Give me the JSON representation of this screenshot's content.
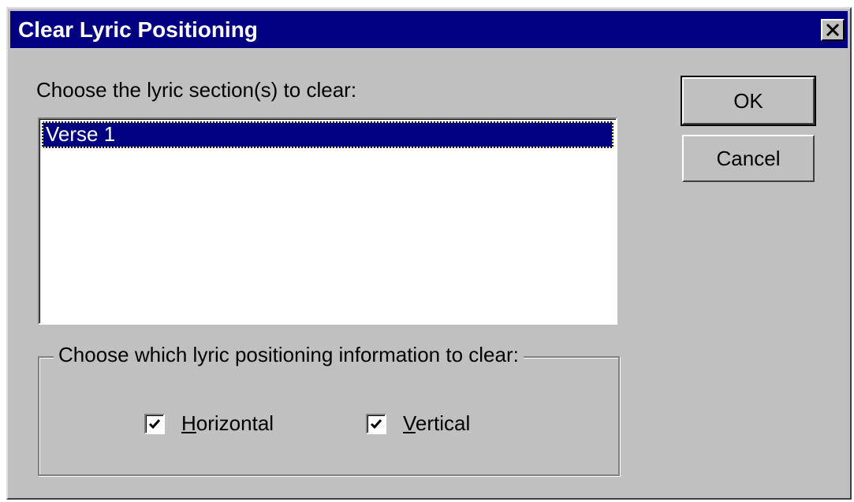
{
  "dialog": {
    "title": "Clear Lyric Positioning",
    "close_icon": "close-x-icon"
  },
  "sections": {
    "prompt": "Choose the lyric section(s) to clear:",
    "items": [
      {
        "label": "Verse 1",
        "selected": true
      }
    ]
  },
  "positioning": {
    "legend": "Choose which lyric positioning information to clear:",
    "horizontal": {
      "mnemonic": "H",
      "rest": "orizontal",
      "checked": true
    },
    "vertical": {
      "mnemonic": "V",
      "rest": "ertical",
      "checked": true
    }
  },
  "buttons": {
    "ok_label": "OK",
    "cancel_label": "Cancel"
  },
  "colors": {
    "titlebar": "#000080",
    "face": "#c0c0c0",
    "selection": "#000080"
  }
}
